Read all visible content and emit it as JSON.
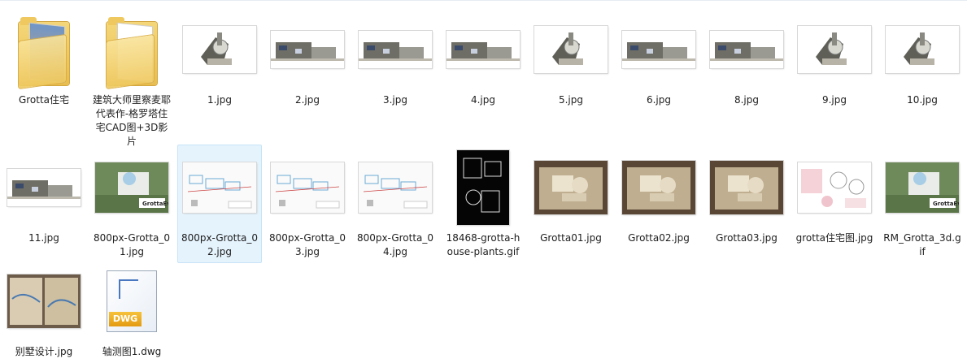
{
  "files": [
    {
      "name": "Grotta住宅",
      "kind": "folder",
      "thumb": "folder-photo"
    },
    {
      "name": "建筑大师里察麦耶代表作-格罗塔住宅CAD图+3D影片",
      "kind": "folder",
      "thumb": "folder-docs"
    },
    {
      "name": "1.jpg",
      "kind": "image",
      "thumb": "render-small"
    },
    {
      "name": "2.jpg",
      "kind": "image",
      "thumb": "render-wide"
    },
    {
      "name": "3.jpg",
      "kind": "image",
      "thumb": "render-wide"
    },
    {
      "name": "4.jpg",
      "kind": "image",
      "thumb": "render-wide"
    },
    {
      "name": "5.jpg",
      "kind": "image",
      "thumb": "render-small"
    },
    {
      "name": "6.jpg",
      "kind": "image",
      "thumb": "render-wide"
    },
    {
      "name": "8.jpg",
      "kind": "image",
      "thumb": "render-wide"
    },
    {
      "name": "9.jpg",
      "kind": "image",
      "thumb": "render-small"
    },
    {
      "name": "10.jpg",
      "kind": "image",
      "thumb": "render-small"
    },
    {
      "name": "11.jpg",
      "kind": "image",
      "thumb": "render-wide"
    },
    {
      "name": "800px-Grotta_01.jpg",
      "kind": "image",
      "thumb": "render-green"
    },
    {
      "name": "800px-Grotta_02.jpg",
      "kind": "image",
      "thumb": "sheet",
      "selected": true
    },
    {
      "name": "800px-Grotta_03.jpg",
      "kind": "image",
      "thumb": "sheet"
    },
    {
      "name": "800px-Grotta_04.jpg",
      "kind": "image",
      "thumb": "sheet"
    },
    {
      "name": "18468-grotta-house-plants.gif",
      "kind": "image",
      "thumb": "plans-black"
    },
    {
      "name": "Grotta01.jpg",
      "kind": "image",
      "thumb": "model-photo"
    },
    {
      "name": "Grotta02.jpg",
      "kind": "image",
      "thumb": "model-photo"
    },
    {
      "name": "Grotta03.jpg",
      "kind": "image",
      "thumb": "model-photo"
    },
    {
      "name": "grotta住宅图.jpg",
      "kind": "image",
      "thumb": "sheet-pink"
    },
    {
      "name": "RM_Grotta_3d.gif",
      "kind": "image",
      "thumb": "render-green"
    },
    {
      "name": "别墅设计.jpg",
      "kind": "image",
      "thumb": "book"
    },
    {
      "name": "轴测图1.dwg",
      "kind": "dwg",
      "thumb": "dwg-file",
      "badge": "DWG"
    }
  ]
}
